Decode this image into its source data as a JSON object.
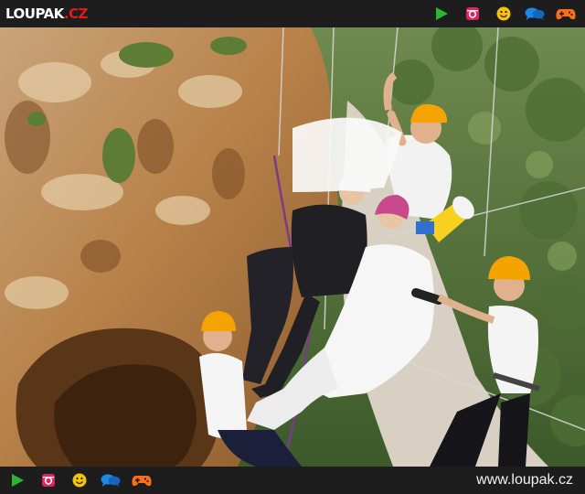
{
  "header": {
    "logo_main": "LOUPAK",
    "logo_tld": ".CZ",
    "icons": [
      "play-icon",
      "instagram-icon",
      "smiley-icon",
      "chat-bubbles-icon",
      "gamepad-icon"
    ]
  },
  "footer": {
    "icons": [
      "play-icon",
      "instagram-icon",
      "smiley-icon",
      "chat-bubbles-icon",
      "gamepad-icon"
    ],
    "site_url": "www.loupak.cz"
  },
  "colors": {
    "bar_bg": "#1d1d1d",
    "play": "#2bb531",
    "instagram": "#e0245e",
    "smiley": "#f4c20d",
    "chat": "#1e88e5",
    "gamepad": "#ff6f1a",
    "logo_accent": "#e21a1a"
  },
  "photo": {
    "subject": "cliff-wedding-rappel",
    "people": [
      "bride-in-white",
      "groom-in-black",
      "climber-top-right",
      "climber-bottom-left",
      "climber-right"
    ]
  }
}
